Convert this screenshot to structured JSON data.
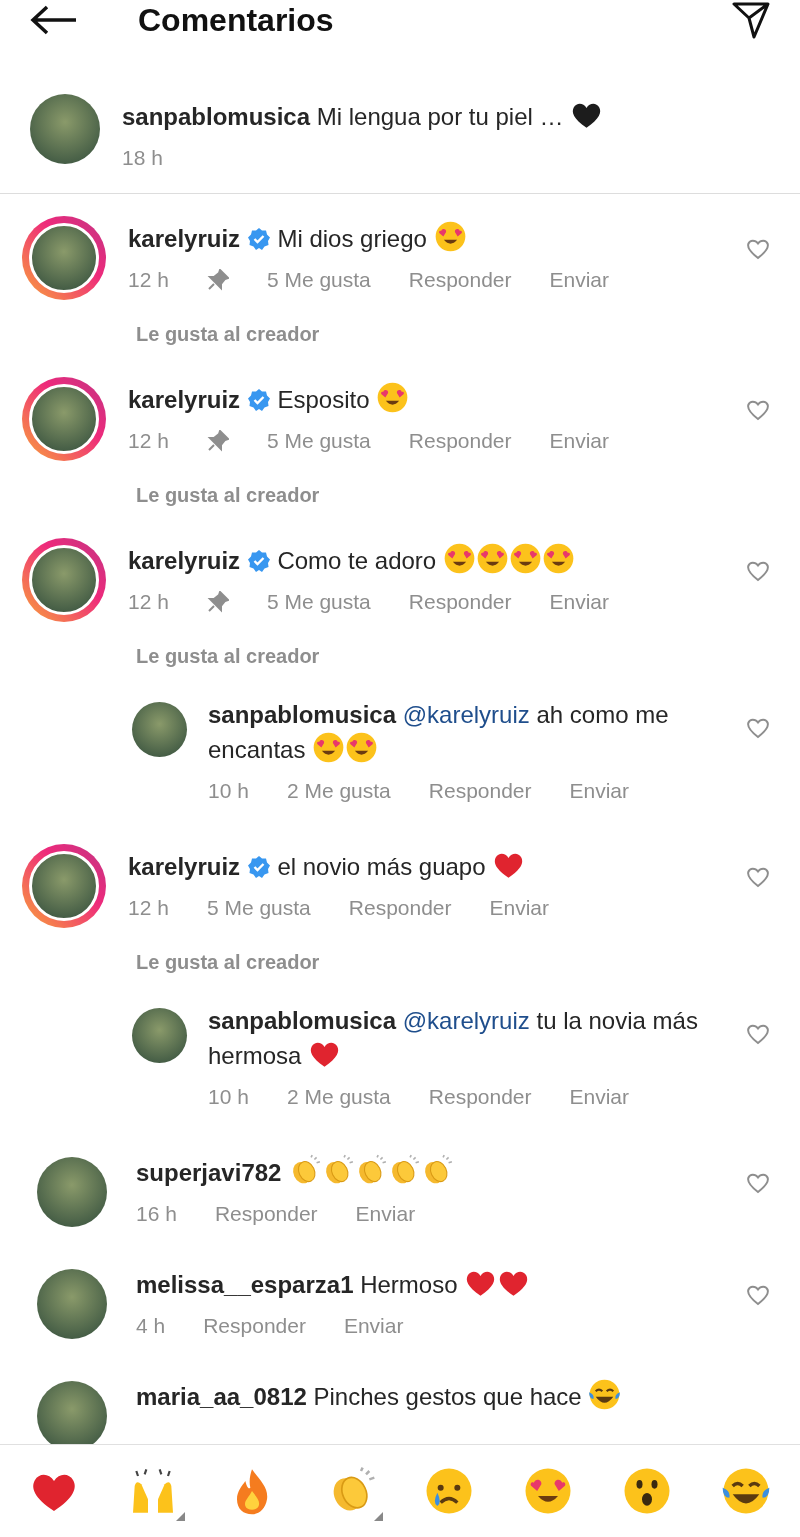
{
  "header": {
    "title": "Comentarios"
  },
  "post_caption": {
    "user": "sanpablomusica",
    "text": "Mi lengua por tu piel …",
    "emojis": [
      {
        "kind": "black_heart"
      }
    ],
    "time": "18 h"
  },
  "comments": [
    {
      "user": "karelyruiz",
      "verified": true,
      "story_ring": true,
      "text": "Mi dios griego",
      "emojis": [
        {
          "kind": "heart_eyes"
        }
      ],
      "time": "12 h",
      "pinned": true,
      "likes": "5 Me gusta",
      "reply": "Responder",
      "send": "Enviar",
      "liked_by_creator": "Le gusta al creador"
    },
    {
      "user": "karelyruiz",
      "verified": true,
      "story_ring": true,
      "text": "Esposito",
      "emojis": [
        {
          "kind": "heart_eyes"
        }
      ],
      "time": "12 h",
      "pinned": true,
      "likes": "5 Me gusta",
      "reply": "Responder",
      "send": "Enviar",
      "liked_by_creator": "Le gusta al creador"
    },
    {
      "user": "karelyruiz",
      "verified": true,
      "story_ring": true,
      "text": "Como te adoro",
      "emojis": [
        {
          "kind": "heart_eyes"
        },
        {
          "kind": "heart_eyes"
        },
        {
          "kind": "heart_eyes"
        },
        {
          "kind": "heart_eyes"
        }
      ],
      "time": "12 h",
      "pinned": true,
      "likes": "5 Me gusta",
      "reply": "Responder",
      "send": "Enviar",
      "liked_by_creator": "Le gusta al creador",
      "replies": [
        {
          "user": "sanpablomusica",
          "verified": false,
          "story_ring": false,
          "mention": "@karelyruiz",
          "text": "ah como me encantas",
          "emojis": [
            {
              "kind": "heart_eyes"
            },
            {
              "kind": "heart_eyes"
            }
          ],
          "time": "10 h",
          "pinned": false,
          "likes": "2 Me gusta",
          "reply": "Responder",
          "send": "Enviar"
        }
      ]
    },
    {
      "user": "karelyruiz",
      "verified": true,
      "story_ring": true,
      "text": "el novio más guapo",
      "emojis": [
        {
          "kind": "red_heart"
        }
      ],
      "time": "12 h",
      "pinned": false,
      "likes": "5 Me gusta",
      "reply": "Responder",
      "send": "Enviar",
      "liked_by_creator": "Le gusta al creador",
      "replies": [
        {
          "user": "sanpablomusica",
          "verified": false,
          "story_ring": false,
          "mention": "@karelyruiz",
          "text": "tu la novia más hermosa",
          "emojis": [
            {
              "kind": "red_heart"
            }
          ],
          "time": "10 h",
          "pinned": false,
          "likes": "2 Me gusta",
          "reply": "Responder",
          "send": "Enviar"
        }
      ]
    },
    {
      "user": "superjavi782",
      "verified": false,
      "story_ring": false,
      "emojis": [
        {
          "kind": "clap"
        },
        {
          "kind": "clap"
        },
        {
          "kind": "clap"
        },
        {
          "kind": "clap"
        },
        {
          "kind": "clap"
        }
      ],
      "time": "16 h",
      "pinned": false,
      "reply": "Responder",
      "send": "Enviar"
    },
    {
      "user": "melissa__esparza1",
      "verified": false,
      "story_ring": false,
      "text": "Hermoso",
      "emojis": [
        {
          "kind": "red_heart"
        },
        {
          "kind": "red_heart"
        }
      ],
      "time": "4 h",
      "pinned": false,
      "reply": "Responder",
      "send": "Enviar"
    },
    {
      "user": "maria_aa_0812",
      "verified": false,
      "story_ring": false,
      "text": "Pinches gestos que hace",
      "emojis": [
        {
          "kind": "laugh_cry"
        }
      ]
    }
  ],
  "reactions": [
    {
      "kind": "red_heart",
      "has_variants": false
    },
    {
      "kind": "raised_hands",
      "has_variants": true
    },
    {
      "kind": "fire",
      "has_variants": false
    },
    {
      "kind": "clap",
      "has_variants": true
    },
    {
      "kind": "crying",
      "has_variants": false
    },
    {
      "kind": "heart_eyes",
      "has_variants": false
    },
    {
      "kind": "wow",
      "has_variants": false
    },
    {
      "kind": "laugh_cry",
      "has_variants": false
    }
  ]
}
